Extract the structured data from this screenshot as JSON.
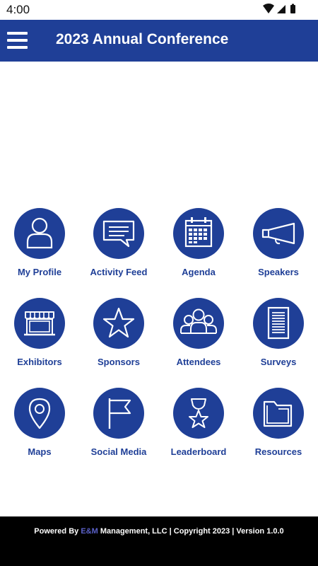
{
  "status_bar": {
    "time": "4:00",
    "icons": [
      "wifi-icon",
      "signal-icon",
      "battery-icon"
    ]
  },
  "app_bar": {
    "title": "2023 Annual Conference",
    "menu_icon": "hamburger-menu-icon",
    "background_color": "#1f3f97"
  },
  "tiles": [
    {
      "label": "My Profile",
      "icon": "person-icon"
    },
    {
      "label": "Activity Feed",
      "icon": "chat-bubble-icon"
    },
    {
      "label": "Agenda",
      "icon": "calendar-icon"
    },
    {
      "label": "Speakers",
      "icon": "megaphone-icon"
    },
    {
      "label": "Exhibitors",
      "icon": "storefront-icon"
    },
    {
      "label": "Sponsors",
      "icon": "star-icon"
    },
    {
      "label": "Attendees",
      "icon": "group-icon"
    },
    {
      "label": "Surveys",
      "icon": "document-list-icon"
    },
    {
      "label": "Maps",
      "icon": "map-pin-icon"
    },
    {
      "label": "Social Media",
      "icon": "flag-icon"
    },
    {
      "label": "Leaderboard",
      "icon": "trophy-star-icon"
    },
    {
      "label": "Resources",
      "icon": "folder-icon"
    }
  ],
  "footer": {
    "prefix": "Powered By ",
    "brand": "E&M",
    "suffix": " Management, LLC | Copyright 2023 | Version 1.0.0"
  },
  "colors": {
    "primary": "#1f3f97",
    "brand_accent": "#5b61c9",
    "footer_bg": "#000000"
  }
}
